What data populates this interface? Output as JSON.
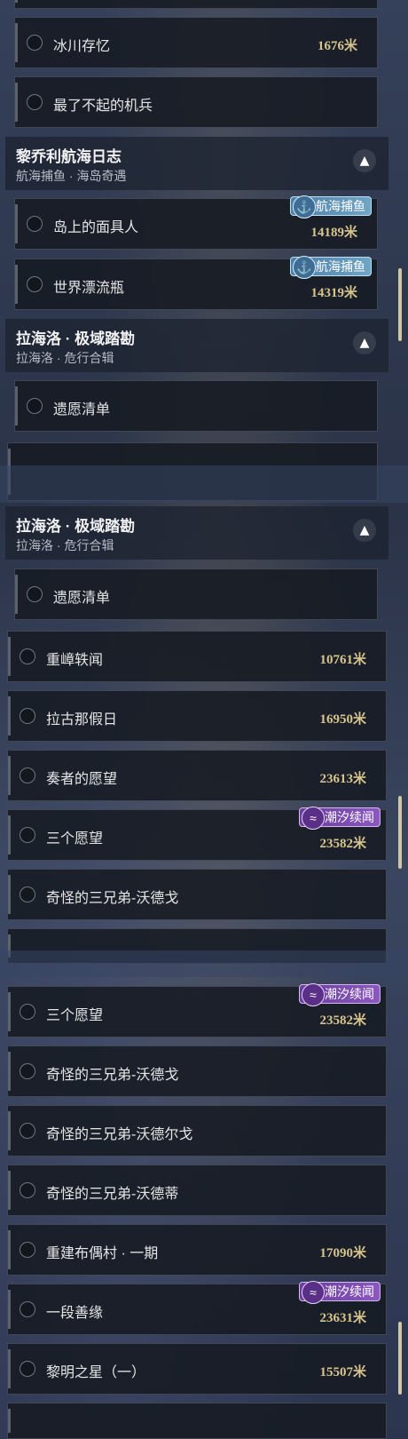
{
  "top_rows": [
    {
      "name": "冰川存忆",
      "distance": "1676米"
    },
    {
      "name": "最了不起的机兵",
      "distance": ""
    }
  ],
  "group1": {
    "title": "黎乔利航海日志",
    "subtitle": "航海捕鱼 · 海岛奇遇"
  },
  "group1_rows": [
    {
      "name": "岛上的面具人",
      "distance": "14189米",
      "tag": "航海捕鱼"
    },
    {
      "name": "世界漂流瓶",
      "distance": "14319米",
      "tag": "航海捕鱼"
    }
  ],
  "group2": {
    "title": "拉海洛 · 极域踏勘",
    "subtitle": "拉海洛 · 危行合辑"
  },
  "group2_rows": [
    {
      "name": "遗愿清单",
      "distance": ""
    }
  ],
  "group3": {
    "title": "拉海洛 · 极域踏勘",
    "subtitle": "拉海洛 · 危行合辑"
  },
  "group3_rows": [
    {
      "name": "遗愿清单",
      "distance": ""
    }
  ],
  "list_rows": [
    {
      "name": "重嶂轶闻",
      "distance": "10761米"
    },
    {
      "name": "拉古那假日",
      "distance": "16950米"
    },
    {
      "name": "奏者的愿望",
      "distance": "23613米"
    },
    {
      "name": "三个愿望",
      "distance": "23582米",
      "tag": "潮汐续闻"
    },
    {
      "name": "奇怪的三兄弟-沃德戈",
      "distance": ""
    }
  ],
  "list_rows_2": [
    {
      "name": "三个愿望",
      "distance": "23582米",
      "tag": "潮汐续闻"
    },
    {
      "name": "奇怪的三兄弟-沃德戈",
      "distance": ""
    },
    {
      "name": "奇怪的三兄弟-沃德尔戈",
      "distance": ""
    },
    {
      "name": "奇怪的三兄弟-沃德蒂",
      "distance": ""
    },
    {
      "name": "重建布偶村 · 一期",
      "distance": "17090米"
    },
    {
      "name": "一段善缘",
      "distance": "23631米",
      "tag": "潮汐续闻"
    },
    {
      "name": "黎明之星（一）",
      "distance": "15507米"
    }
  ]
}
